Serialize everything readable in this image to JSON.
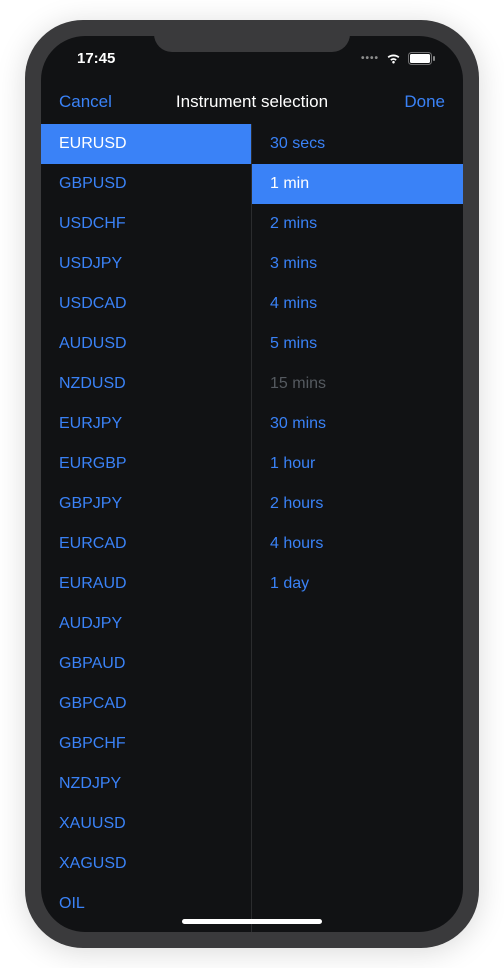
{
  "statusBar": {
    "time": "17:45"
  },
  "navBar": {
    "cancel": "Cancel",
    "title": "Instrument selection",
    "done": "Done"
  },
  "instruments": [
    {
      "label": "EURUSD",
      "selected": true
    },
    {
      "label": "GBPUSD"
    },
    {
      "label": "USDCHF"
    },
    {
      "label": "USDJPY"
    },
    {
      "label": "USDCAD"
    },
    {
      "label": "AUDUSD"
    },
    {
      "label": "NZDUSD"
    },
    {
      "label": "EURJPY"
    },
    {
      "label": "EURGBP"
    },
    {
      "label": "GBPJPY"
    },
    {
      "label": "EURCAD"
    },
    {
      "label": "EURAUD"
    },
    {
      "label": "AUDJPY"
    },
    {
      "label": "GBPAUD"
    },
    {
      "label": "GBPCAD"
    },
    {
      "label": "GBPCHF"
    },
    {
      "label": "NZDJPY"
    },
    {
      "label": "XAUUSD"
    },
    {
      "label": "XAGUSD"
    },
    {
      "label": "OIL"
    }
  ],
  "timeframes": [
    {
      "label": "30 secs"
    },
    {
      "label": "1 min",
      "selected": true
    },
    {
      "label": "2 mins"
    },
    {
      "label": "3 mins"
    },
    {
      "label": "4 mins"
    },
    {
      "label": "5 mins"
    },
    {
      "label": "15 mins",
      "dimmed": true
    },
    {
      "label": "30 mins"
    },
    {
      "label": "1 hour"
    },
    {
      "label": "2 hours"
    },
    {
      "label": "4 hours"
    },
    {
      "label": "1 day"
    }
  ]
}
